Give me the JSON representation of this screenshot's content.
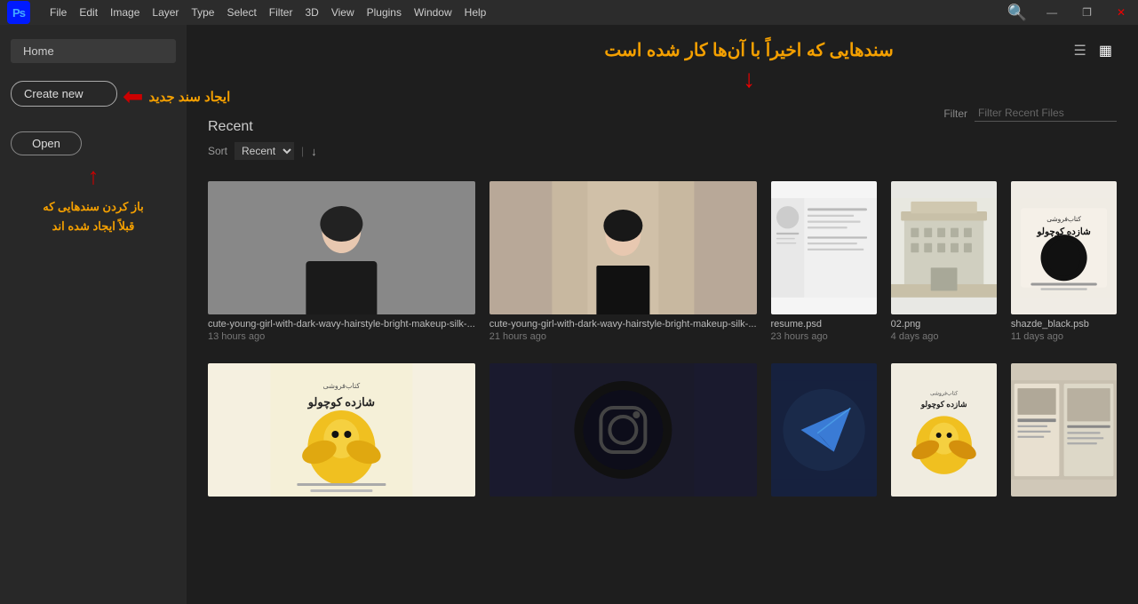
{
  "titlebar": {
    "logo": "Ps",
    "menu_items": [
      "File",
      "Edit",
      "Image",
      "Layer",
      "Type",
      "Select",
      "Filter",
      "3D",
      "View",
      "Plugins",
      "Window",
      "Help"
    ],
    "win_buttons": [
      "—",
      "❐",
      "✕"
    ]
  },
  "sidebar": {
    "home_label": "Home",
    "create_new_label": "Create new",
    "open_label": "Open",
    "annotation_create": "ایجاد سند جدید",
    "annotation_open_line1": "باز کردن سندهایی که",
    "annotation_open_line2": "قبلاً ایجاد شده اند"
  },
  "top_annotation": "سندهایی که اخیراً با آن‌ها کار شده است",
  "recent": {
    "title": "Recent",
    "sort_label": "Sort",
    "sort_option": "Recent",
    "filter_label": "Filter",
    "filter_placeholder": "Filter Recent Files"
  },
  "files": [
    {
      "name": "cute-young-girl-with-dark-wavy-hairstyle-bright-makeup-silk-...",
      "time": "13 hours ago",
      "type": "woman1"
    },
    {
      "name": "cute-young-girl-with-dark-wavy-hairstyle-bright-makeup-silk-...",
      "time": "21 hours ago",
      "type": "woman2"
    },
    {
      "name": "resume.psd",
      "time": "23 hours ago",
      "type": "resume"
    },
    {
      "name": "02.png",
      "time": "4 days ago",
      "type": "building"
    },
    {
      "name": "shazde_black.psb",
      "time": "11 days ago",
      "type": "blacklogo"
    },
    {
      "name": "",
      "time": "",
      "type": "logoyellow"
    },
    {
      "name": "",
      "time": "",
      "type": "darkoval"
    },
    {
      "name": "",
      "time": "",
      "type": "telegram"
    },
    {
      "name": "",
      "time": "",
      "type": "logoyellow2"
    },
    {
      "name": "",
      "time": "",
      "type": "magazine"
    }
  ]
}
